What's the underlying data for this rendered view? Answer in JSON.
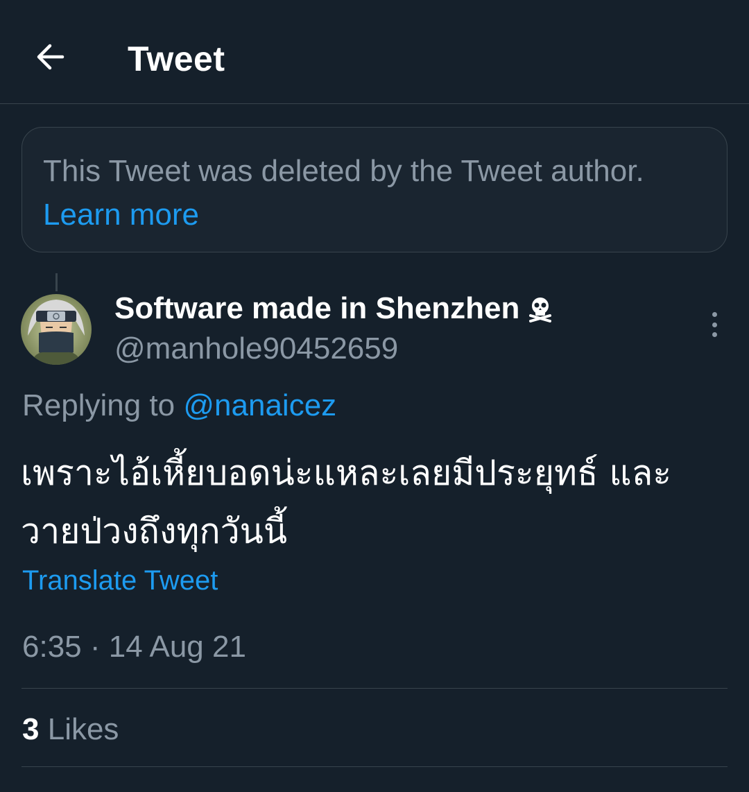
{
  "header": {
    "title": "Tweet",
    "back_icon": "arrow-left-icon"
  },
  "deleted_notice": {
    "text": "This Tweet was deleted by the Tweet author.",
    "link_label": "Learn more"
  },
  "tweet": {
    "author": {
      "name": "Software made in Shenzhen",
      "name_emoji_icon": "skull-crossbones-icon",
      "handle": "@manhole90452659",
      "avatar_icon": "ninja-avatar"
    },
    "replying_prefix": "Replying to",
    "replying_to": "@nanaicez",
    "text_line1": "เพราะไอ้เหี้ยบอดน่ะแหละเลยมีประยุทธ์ และ",
    "text_line2": "วายป่วงถึงทุกวันนี้",
    "translate_label": "Translate Tweet",
    "timestamp": "6:35 · 14 Aug 21",
    "likes_count": "3",
    "likes_label": "Likes"
  },
  "colors": {
    "background": "#15202b",
    "accent": "#1d9bf0",
    "muted_text": "#8b98a5",
    "border": "#38444d"
  }
}
